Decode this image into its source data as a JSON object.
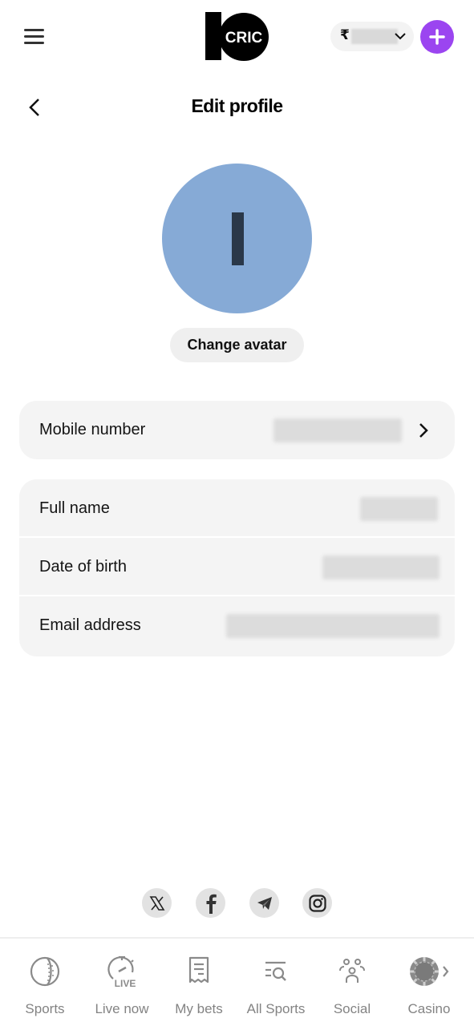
{
  "header": {
    "logo_text": "CRIC",
    "logo_number": "10",
    "currency_symbol": "₹",
    "balance_hidden": true,
    "accent_color": "#9b45f0"
  },
  "page": {
    "title": "Edit profile"
  },
  "avatar": {
    "initial": "I",
    "background_color": "#86aad6",
    "change_label": "Change avatar"
  },
  "mobile": {
    "label": "Mobile number",
    "value_redacted": true
  },
  "details": [
    {
      "label": "Full name",
      "value_redacted": true
    },
    {
      "label": "Date of birth",
      "value_redacted": true
    },
    {
      "label": "Email address",
      "value_redacted": true
    }
  ],
  "social": [
    {
      "name": "X",
      "icon": "x-icon"
    },
    {
      "name": "Facebook",
      "icon": "facebook-icon"
    },
    {
      "name": "Telegram",
      "icon": "telegram-icon"
    },
    {
      "name": "Instagram",
      "icon": "instagram-icon"
    }
  ],
  "bottom_nav": [
    {
      "label": "Sports",
      "icon": "cricket-ball-icon"
    },
    {
      "label": "Live now",
      "icon": "live-stopwatch-icon"
    },
    {
      "label": "My bets",
      "icon": "receipt-icon"
    },
    {
      "label": "All Sports",
      "icon": "list-search-icon"
    },
    {
      "label": "Social",
      "icon": "people-icon"
    },
    {
      "label": "Casino",
      "icon": "casino-chip-icon"
    }
  ]
}
